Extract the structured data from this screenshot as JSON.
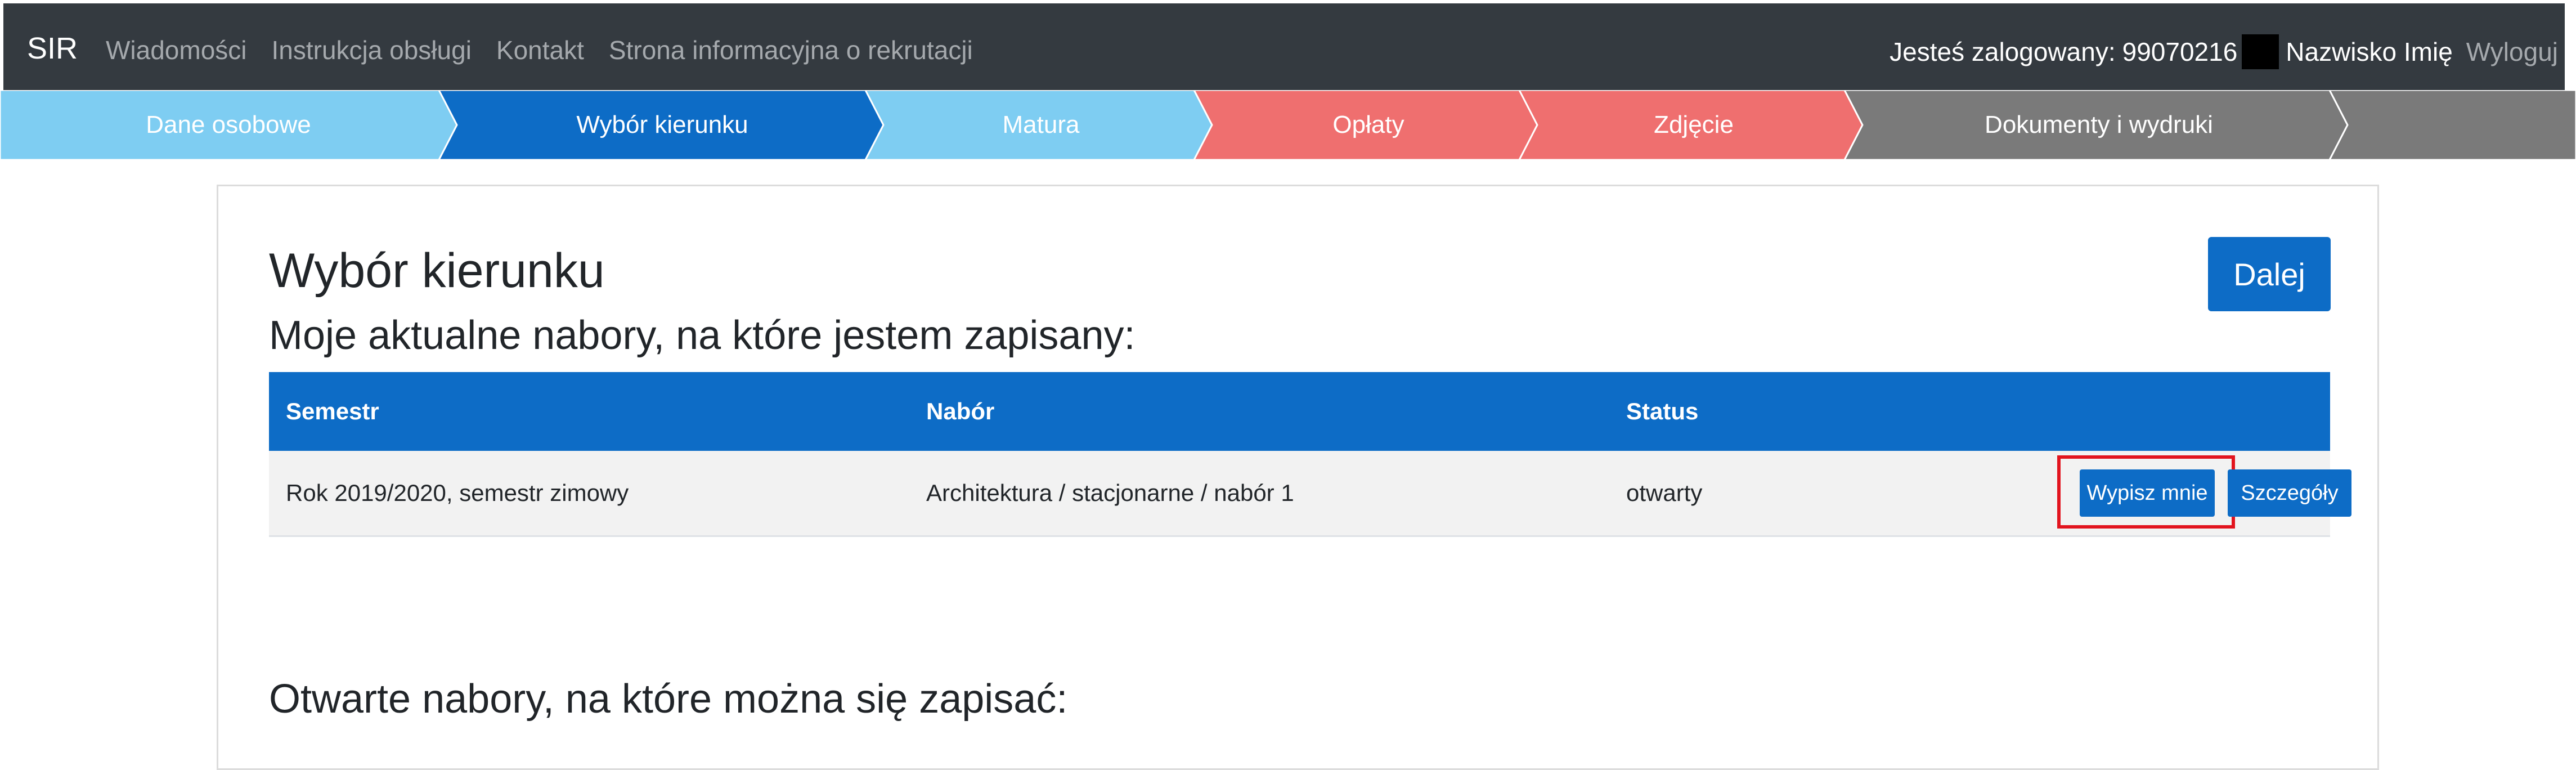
{
  "navbar": {
    "brand": "SIR",
    "links": [
      "Wiadomości",
      "Instrukcja obsługi",
      "Kontakt",
      "Strona informacyjna o rekrutacji"
    ],
    "logged_label": "Jesteś zalogowany:",
    "logged_id": "99070216",
    "user_name": "Nazwisko Imię",
    "logout": "Wyloguj"
  },
  "steps": [
    {
      "label": "Dane osobowe",
      "color": "#7ecdf2"
    },
    {
      "label": "Wybór kierunku",
      "color": "#0d6cc6"
    },
    {
      "label": "Matura",
      "color": "#7ecdf2"
    },
    {
      "label": "Opłaty",
      "color": "#ef6f6f"
    },
    {
      "label": "Zdjęcie",
      "color": "#ef6f6f"
    },
    {
      "label": "Dokumenty i wydruki",
      "color": "#7a7a7a"
    }
  ],
  "main": {
    "title": "Wybór kierunku",
    "next_button": "Dalej",
    "current_section_title": "Moje aktualne nabory, na które jestem zapisany:",
    "open_section_title": "Otwarte nabory, na które można się zapisać:",
    "table": {
      "headers": [
        "Semestr",
        "Nabór",
        "Status"
      ],
      "rows": [
        {
          "semester": "Rok 2019/2020, semestr zimowy",
          "recruitment": "Architektura / stacjonarne / nabór 1",
          "status": "otwarty",
          "unsubscribe_label": "Wypisz mnie",
          "details_label": "Szczegóły"
        }
      ]
    }
  },
  "colors": {
    "navbar_bg": "#343a40",
    "primary": "#0d6cc6",
    "highlight": "#e2141e"
  }
}
